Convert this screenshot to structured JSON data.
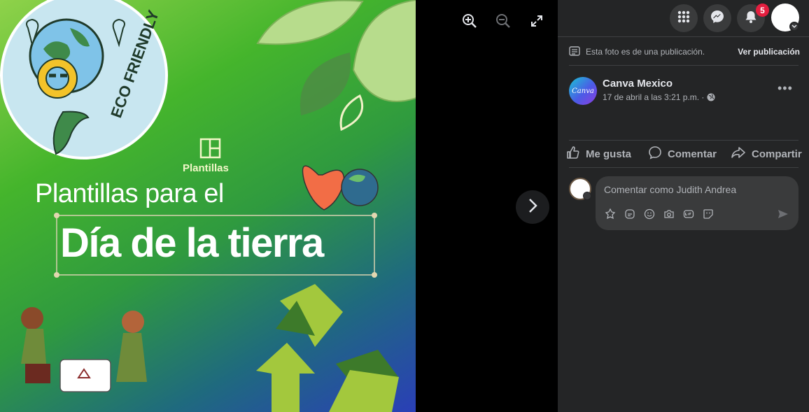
{
  "photo": {
    "sticker_text": "ECO FRIENDLY",
    "brand_label": "Plantillas",
    "headline_line1": "Plantillas para el",
    "headline_line2": "Día de la tierra"
  },
  "viewer": {
    "zoom_in": "zoom-in-icon",
    "zoom_out": "zoom-out-icon",
    "fullscreen": "fullscreen-icon",
    "next": "chevron-right-icon"
  },
  "topbar": {
    "notifications_count": "5"
  },
  "post": {
    "publication_notice": "Esta foto es de una publicación.",
    "view_post_link": "Ver publicación",
    "author_name": "Canva Mexico",
    "author_logo_text": "Canva",
    "timestamp": "17 de abril a las 3:21 p.m. ·"
  },
  "actions": {
    "like": "Me gusta",
    "comment": "Comentar",
    "share": "Compartir"
  },
  "comment_box": {
    "placeholder": "Comentar como Judith Andrea"
  },
  "colors": {
    "sidebar_bg": "#242526",
    "notification_badge": "#e41e3f"
  }
}
